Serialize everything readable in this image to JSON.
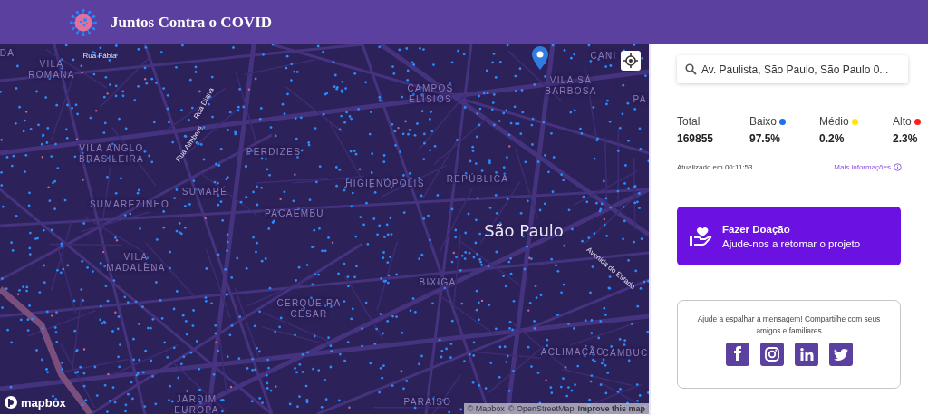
{
  "header": {
    "title": "Juntos Contra o COVID"
  },
  "map": {
    "labels": [
      {
        "kind": "district",
        "lines": [
          "DA"
        ]
      },
      {
        "kind": "street",
        "lines": [
          "Rua Fábia"
        ]
      },
      {
        "kind": "district",
        "lines": [
          "VILA",
          "ROMANA"
        ]
      },
      {
        "kind": "street",
        "lines": [
          "Rua Diana"
        ]
      },
      {
        "kind": "street",
        "lines": [
          "Rua Aimberê"
        ]
      },
      {
        "kind": "district",
        "lines": [
          "VILA ANGLO",
          "BRASILEIRA"
        ]
      },
      {
        "kind": "district",
        "lines": [
          "PERDIZES"
        ]
      },
      {
        "kind": "district",
        "lines": [
          "CAMPOS",
          "ELÍSIOS"
        ]
      },
      {
        "kind": "district",
        "lines": [
          "CANI"
        ]
      },
      {
        "kind": "district",
        "lines": [
          "VILA SÁ",
          "BARBOSA"
        ]
      },
      {
        "kind": "district",
        "lines": [
          "PA"
        ]
      },
      {
        "kind": "district",
        "lines": [
          "SUMARÉ"
        ]
      },
      {
        "kind": "district",
        "lines": [
          "SUMAREZINHO"
        ]
      },
      {
        "kind": "district",
        "lines": [
          "HIGIENÓPOLIS"
        ]
      },
      {
        "kind": "district",
        "lines": [
          "REPÚBLICA"
        ]
      },
      {
        "kind": "district",
        "lines": [
          "PACAEMBU"
        ]
      },
      {
        "kind": "city",
        "lines": [
          "São Paulo"
        ]
      },
      {
        "kind": "street",
        "lines": [
          "Avenida do Estado"
        ]
      },
      {
        "kind": "district",
        "lines": [
          "VILA",
          "MADALENA"
        ]
      },
      {
        "kind": "district",
        "lines": [
          "BIXIGA"
        ]
      },
      {
        "kind": "district",
        "lines": [
          "CERQUEIRA",
          "CÉSAR"
        ]
      },
      {
        "kind": "district",
        "lines": [
          "ACLIMAÇÃO"
        ]
      },
      {
        "kind": "district",
        "lines": [
          "CAMBUC"
        ]
      },
      {
        "kind": "district",
        "lines": [
          "JARDIM",
          "EUROPA"
        ]
      },
      {
        "kind": "district",
        "lines": [
          "PARAÍSO"
        ]
      }
    ],
    "logo": "mapbox",
    "attribution": [
      {
        "kind": "credit",
        "text": "© Mapbox"
      },
      {
        "kind": "credit",
        "text": "© OpenStreetMap"
      },
      {
        "kind": "improve",
        "text": "Improve this map"
      }
    ]
  },
  "search": {
    "value": "Av. Paulista, São Paulo, São Paulo 0..."
  },
  "stats": [
    {
      "label": "Total",
      "value": "169855"
    },
    {
      "label": "Baixo",
      "value": "97.5%",
      "color": "#1a6ef5"
    },
    {
      "label": "Médio",
      "value": "0.2%",
      "color": "#ffe500"
    },
    {
      "label": "Alto",
      "value": "2.3%",
      "color": "#ff1f1f"
    }
  ],
  "updated": "Atualizado em 00:11:53",
  "more_info": "Mais informações",
  "donate": {
    "title": "Fazer Doação",
    "subtitle": "Ajude-nos a retomar o projeto"
  },
  "share": {
    "message": "Ajude a espalhar a mensagem! Compartilhe com seus amigos e familiares",
    "networks": [
      {
        "kind": "facebook"
      },
      {
        "kind": "instagram"
      },
      {
        "kind": "linkedin"
      },
      {
        "kind": "twitter"
      }
    ]
  }
}
